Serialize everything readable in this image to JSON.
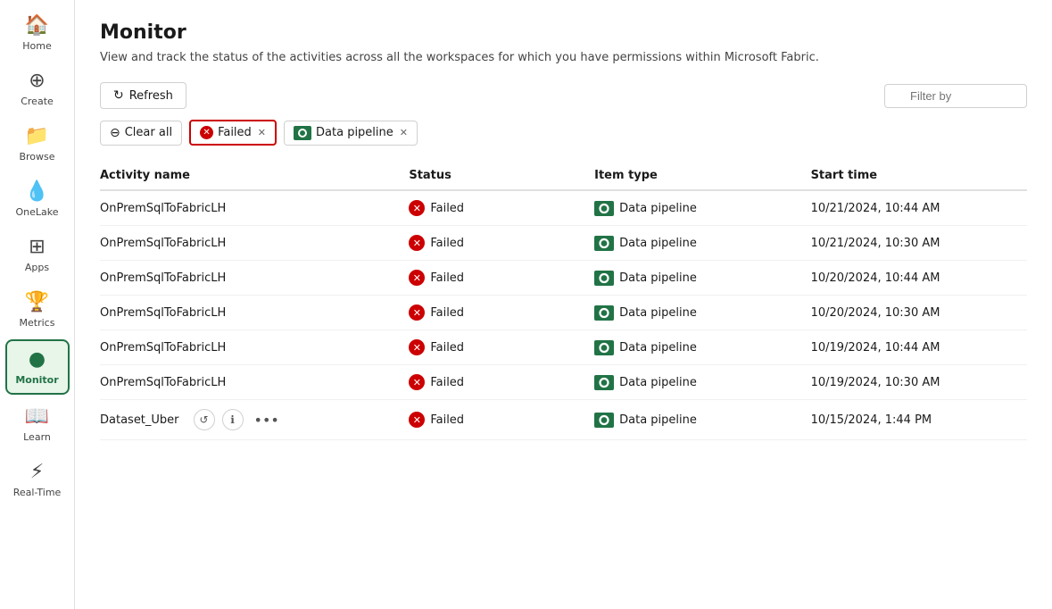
{
  "sidebar": {
    "items": [
      {
        "id": "home",
        "label": "Home",
        "icon": "🏠",
        "active": false
      },
      {
        "id": "create",
        "label": "Create",
        "icon": "⊕",
        "active": false
      },
      {
        "id": "browse",
        "label": "Browse",
        "icon": "📁",
        "active": false
      },
      {
        "id": "onelake",
        "label": "OneLake",
        "icon": "💧",
        "active": false
      },
      {
        "id": "apps",
        "label": "Apps",
        "icon": "⊞",
        "active": false
      },
      {
        "id": "metrics",
        "label": "Metrics",
        "icon": "🏆",
        "active": false
      },
      {
        "id": "monitor",
        "label": "Monitor",
        "icon": "●",
        "active": true
      },
      {
        "id": "learn",
        "label": "Learn",
        "icon": "📖",
        "active": false
      },
      {
        "id": "realtime",
        "label": "Real-Time",
        "icon": "⚡",
        "active": false
      }
    ]
  },
  "page": {
    "title": "Monitor",
    "subtitle": "View and track the status of the activities across all the workspaces for which you have permissions within Microsoft Fabric."
  },
  "toolbar": {
    "refresh_label": "Refresh",
    "filter_placeholder": "Filter by"
  },
  "filter_bar": {
    "clear_all_label": "Clear all",
    "chips": [
      {
        "id": "failed",
        "label": "Failed",
        "highlighted": true
      },
      {
        "id": "data-pipeline",
        "label": "Data pipeline",
        "highlighted": false
      }
    ]
  },
  "table": {
    "columns": [
      "Activity name",
      "Status",
      "Item type",
      "Start time"
    ],
    "rows": [
      {
        "name": "OnPremSqlToFabricLH",
        "status": "Failed",
        "item_type": "Data pipeline",
        "start_time": "10/21/2024, 10:44 AM",
        "has_actions": false
      },
      {
        "name": "OnPremSqlToFabricLH",
        "status": "Failed",
        "item_type": "Data pipeline",
        "start_time": "10/21/2024, 10:30 AM",
        "has_actions": false
      },
      {
        "name": "OnPremSqlToFabricLH",
        "status": "Failed",
        "item_type": "Data pipeline",
        "start_time": "10/20/2024, 10:44 AM",
        "has_actions": false
      },
      {
        "name": "OnPremSqlToFabricLH",
        "status": "Failed",
        "item_type": "Data pipeline",
        "start_time": "10/20/2024, 10:30 AM",
        "has_actions": false
      },
      {
        "name": "OnPremSqlToFabricLH",
        "status": "Failed",
        "item_type": "Data pipeline",
        "start_time": "10/19/2024, 10:44 AM",
        "has_actions": false
      },
      {
        "name": "OnPremSqlToFabricLH",
        "status": "Failed",
        "item_type": "Data pipeline",
        "start_time": "10/19/2024, 10:30 AM",
        "has_actions": false
      },
      {
        "name": "Dataset_Uber",
        "status": "Failed",
        "item_type": "Data pipeline",
        "start_time": "10/15/2024, 1:44 PM",
        "has_actions": true
      }
    ]
  }
}
